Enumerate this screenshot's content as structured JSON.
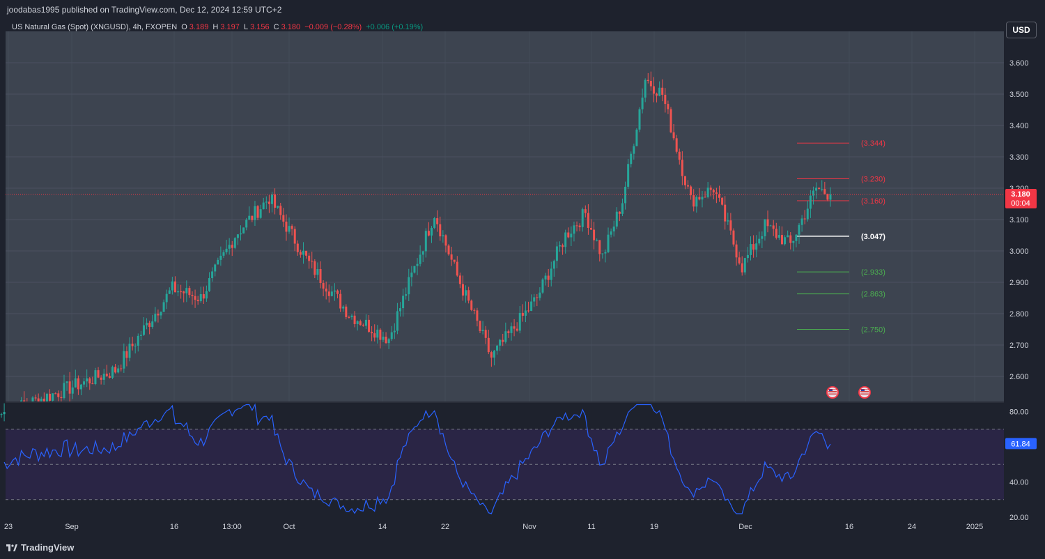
{
  "header": {
    "published": "joodabas1995 published on TradingView.com, Dec 12, 2024 12:59 UTC+2"
  },
  "legend": {
    "symbol": "US Natural Gas (Spot) (XNGUSD), 4h, FXOPEN",
    "o_label": "O",
    "o_value": "3.189",
    "h_label": "H",
    "h_value": "3.197",
    "l_label": "L",
    "l_value": "3.156",
    "c_label": "C",
    "c_value": "3.180",
    "change": "−0.009 (−0.28%)",
    "change2": "+0.006 (+0.19%)"
  },
  "currency_button": "USD",
  "logo_text": "TradingView",
  "colors": {
    "background": "#1e222d",
    "main_pane": "#3d4450",
    "up": "#26a69a",
    "down": "#ef5350",
    "rsi_line": "#2962ff",
    "rsi_band": "#2a2545",
    "level_red": "#f23645",
    "level_green": "#4caf50",
    "level_white": "#ffffff"
  },
  "chart_data": [
    {
      "type": "candlestick",
      "pane": "price",
      "ylim": [
        2.52,
        3.7
      ],
      "y_ticks": [
        "3.600",
        "3.500",
        "3.400",
        "3.300",
        "3.200",
        "3.100",
        "3.000",
        "2.900",
        "2.800",
        "2.700",
        "2.600"
      ],
      "x_ticks": [
        "23",
        "Sep",
        "16",
        "13:00",
        "Oct",
        "14",
        "22",
        "Nov",
        "11",
        "19",
        "Dec",
        "16",
        "24",
        "2025"
      ],
      "price_path": [
        {
          "index": 0,
          "close": 2.48
        },
        {
          "index": 40,
          "close": 2.62
        },
        {
          "index": 60,
          "close": 2.88
        },
        {
          "index": 70,
          "close": 2.85
        },
        {
          "index": 82,
          "close": 3.05
        },
        {
          "index": 94,
          "close": 3.17
        },
        {
          "index": 108,
          "close": 2.96
        },
        {
          "index": 122,
          "close": 2.8
        },
        {
          "index": 136,
          "close": 2.72
        },
        {
          "index": 152,
          "close": 3.12
        },
        {
          "index": 160,
          "close": 2.92
        },
        {
          "index": 172,
          "close": 2.66
        },
        {
          "index": 188,
          "close": 2.85
        },
        {
          "index": 198,
          "close": 3.05
        },
        {
          "index": 205,
          "close": 3.12
        },
        {
          "index": 211,
          "close": 2.98
        },
        {
          "index": 218,
          "close": 3.16
        },
        {
          "index": 226,
          "close": 3.55
        },
        {
          "index": 232,
          "close": 3.5
        },
        {
          "index": 242,
          "close": 3.16
        },
        {
          "index": 250,
          "close": 3.2
        },
        {
          "index": 260,
          "close": 2.95
        },
        {
          "index": 268,
          "close": 3.08
        },
        {
          "index": 277,
          "close": 3.02
        },
        {
          "index": 286,
          "close": 3.2
        },
        {
          "index": 291,
          "close": 3.18
        }
      ],
      "current_price": {
        "value": 3.18,
        "label": "3.180",
        "countdown": "00:04"
      },
      "levels": [
        {
          "value": 3.344,
          "label": "(3.344)",
          "color": "red"
        },
        {
          "value": 3.23,
          "label": "(3.230)",
          "color": "red"
        },
        {
          "value": 3.16,
          "label": "(3.160)",
          "color": "red"
        },
        {
          "value": 3.047,
          "label": "(3.047)",
          "color": "white"
        },
        {
          "value": 2.933,
          "label": "(2.933)",
          "color": "green"
        },
        {
          "value": 2.863,
          "label": "(2.863)",
          "color": "green"
        },
        {
          "value": 2.75,
          "label": "(2.750)",
          "color": "green"
        }
      ],
      "event_markers": [
        "us-flag-icon",
        "us-flag-icon"
      ]
    },
    {
      "type": "line",
      "pane": "rsi",
      "ylim": [
        20,
        85
      ],
      "y_ticks": [
        "80.00",
        "40.00",
        "20.00"
      ],
      "band": [
        30,
        70
      ],
      "midline": 50,
      "current_value": {
        "value": 61.84,
        "label": "61.84"
      }
    }
  ]
}
